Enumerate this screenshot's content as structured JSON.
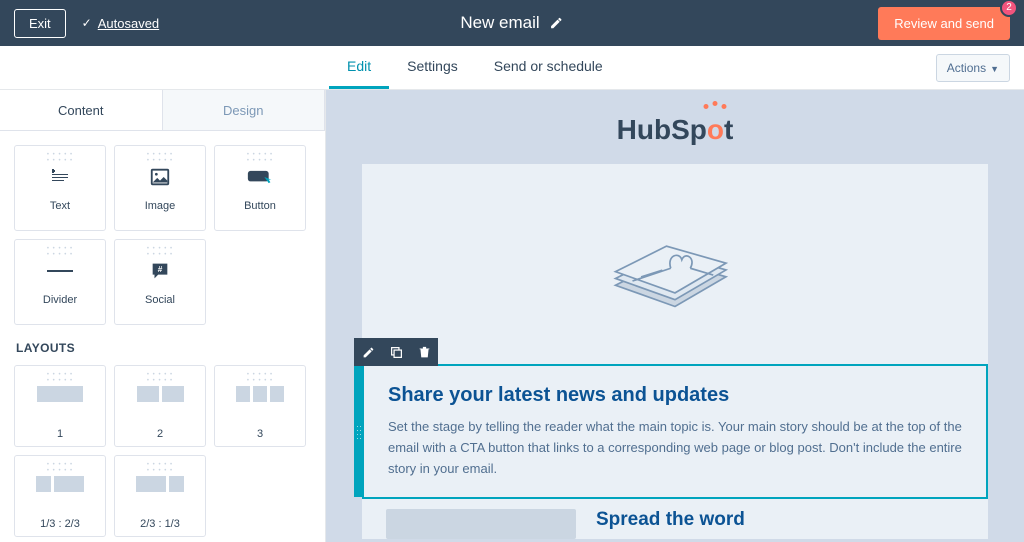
{
  "topbar": {
    "exit_label": "Exit",
    "autosaved_label": "Autosaved",
    "title": "New email",
    "review_label": "Review and send",
    "review_badge": "2"
  },
  "secnav": {
    "tabs": [
      {
        "label": "Edit",
        "active": true
      },
      {
        "label": "Settings"
      },
      {
        "label": "Send or schedule"
      }
    ],
    "actions_label": "Actions"
  },
  "left_panel": {
    "tabs": {
      "content": "Content",
      "design": "Design"
    },
    "blocks": {
      "text": "Text",
      "image": "Image",
      "button": "Button",
      "divider": "Divider",
      "social": "Social"
    },
    "layouts_heading": "LAYOUTS",
    "layouts": {
      "l1": "1",
      "l2": "2",
      "l3": "3",
      "l4": "1/3 : 2/3",
      "l5": "2/3 : 1/3"
    }
  },
  "canvas": {
    "logo_left": "HubSp",
    "logo_right": "t",
    "content_block": {
      "heading": "Share your latest news and updates",
      "body": "Set the stage by telling the reader what the main topic is. Your main story should be at the top of the email with a CTA button that links to a corresponding web page or blog post. Don't include the entire story in your email."
    },
    "spread": {
      "heading": "Spread the word"
    }
  }
}
